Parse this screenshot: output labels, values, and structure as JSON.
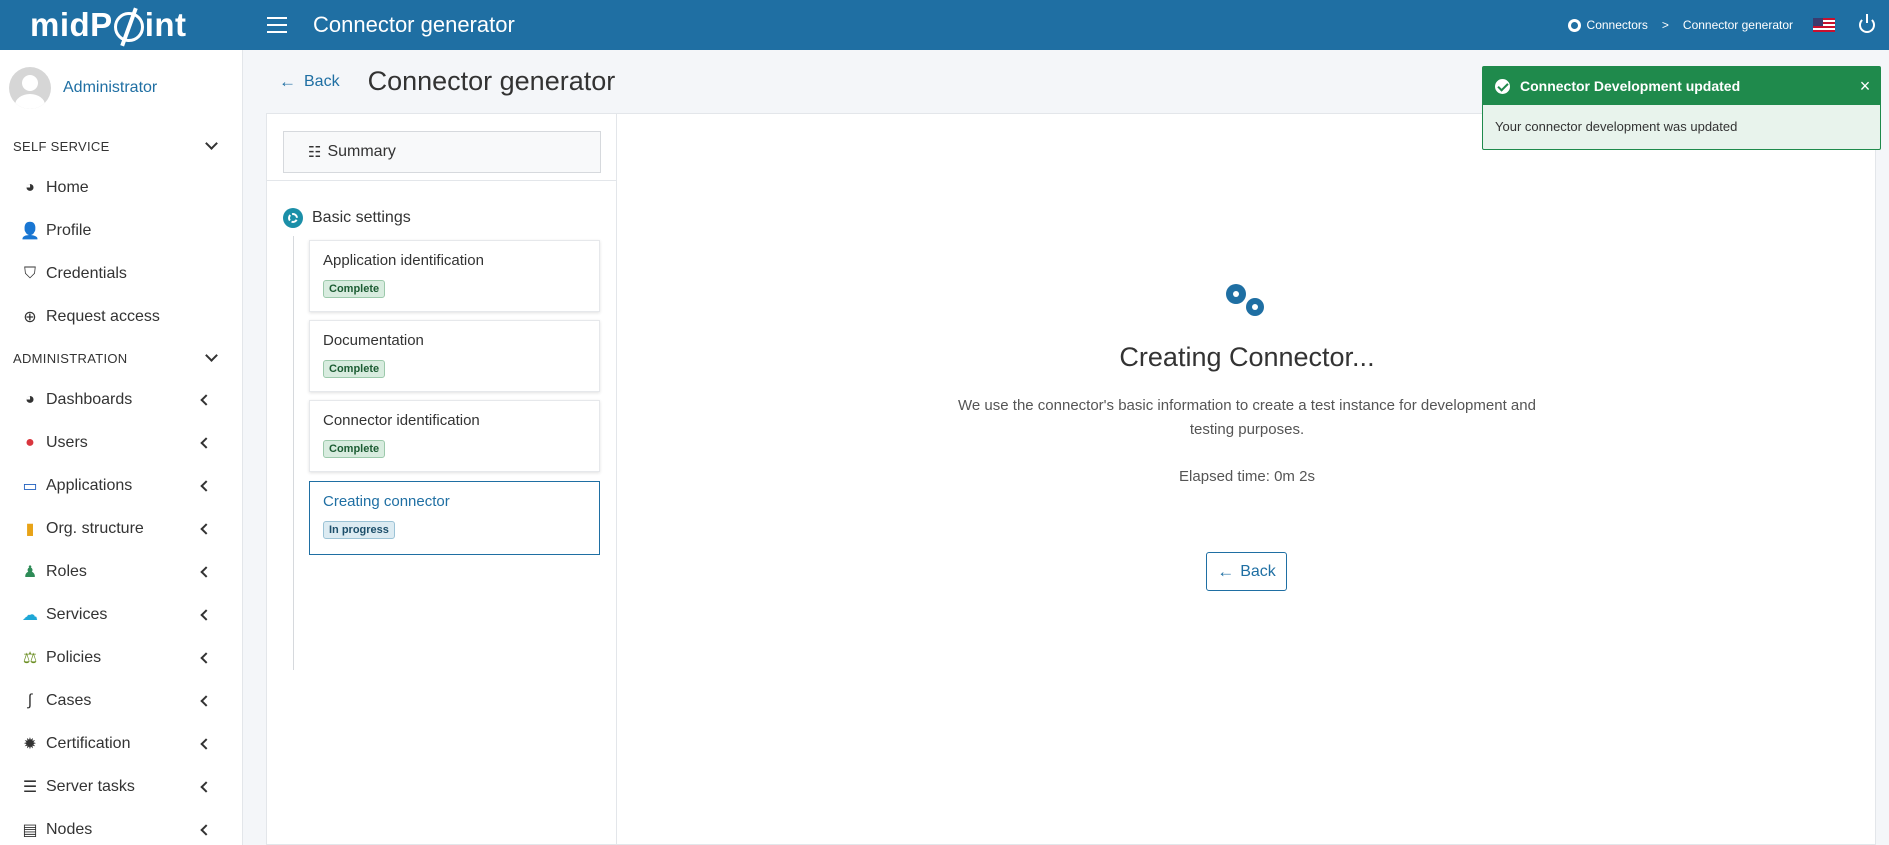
{
  "header": {
    "logo_text": "midPoint",
    "title": "Connector generator",
    "breadcrumbs": [
      "Connectors",
      "Connector generator"
    ],
    "breadcrumb_separator": ">"
  },
  "sidebar": {
    "user_name": "Administrator",
    "sections": [
      {
        "label": "SELF SERVICE",
        "items": [
          {
            "label": "Home",
            "icon": "dashboard-gauge-icon"
          },
          {
            "label": "Profile",
            "icon": "user-icon"
          },
          {
            "label": "Credentials",
            "icon": "shield-icon"
          },
          {
            "label": "Request access",
            "icon": "plus-circle-icon"
          }
        ]
      },
      {
        "label": "ADMINISTRATION",
        "items": [
          {
            "label": "Dashboards",
            "icon": "dashboard-gauge-icon"
          },
          {
            "label": "Users",
            "icon": "user-icon"
          },
          {
            "label": "Applications",
            "icon": "monitor-icon"
          },
          {
            "label": "Org. structure",
            "icon": "building-icon"
          },
          {
            "label": "Roles",
            "icon": "role-icon"
          },
          {
            "label": "Services",
            "icon": "cloud-icon"
          },
          {
            "label": "Policies",
            "icon": "balance-scale-icon"
          },
          {
            "label": "Cases",
            "icon": "route-icon"
          },
          {
            "label": "Certification",
            "icon": "certificate-icon"
          },
          {
            "label": "Server tasks",
            "icon": "task-list-icon"
          },
          {
            "label": "Nodes",
            "icon": "server-icon"
          }
        ]
      }
    ]
  },
  "content": {
    "back_label": "Back",
    "title": "Connector generator"
  },
  "steps": {
    "summary_label": "Summary",
    "group_label": "Basic settings",
    "items": [
      {
        "title": "Application identification",
        "status": "Complete"
      },
      {
        "title": "Documentation",
        "status": "Complete"
      },
      {
        "title": "Connector identification",
        "status": "Complete"
      },
      {
        "title": "Creating connector",
        "status": "In progress"
      }
    ]
  },
  "main": {
    "heading": "Creating Connector...",
    "description": "We use the connector's basic information to create a test instance for development and testing purposes.",
    "elapsed": "Elapsed time: 0m 2s",
    "back_button": "Back"
  },
  "toast": {
    "title": "Connector Development updated",
    "message": "Your connector development was updated"
  },
  "colors": {
    "primary": "#1f6fa3",
    "success": "#1f8a4c"
  }
}
